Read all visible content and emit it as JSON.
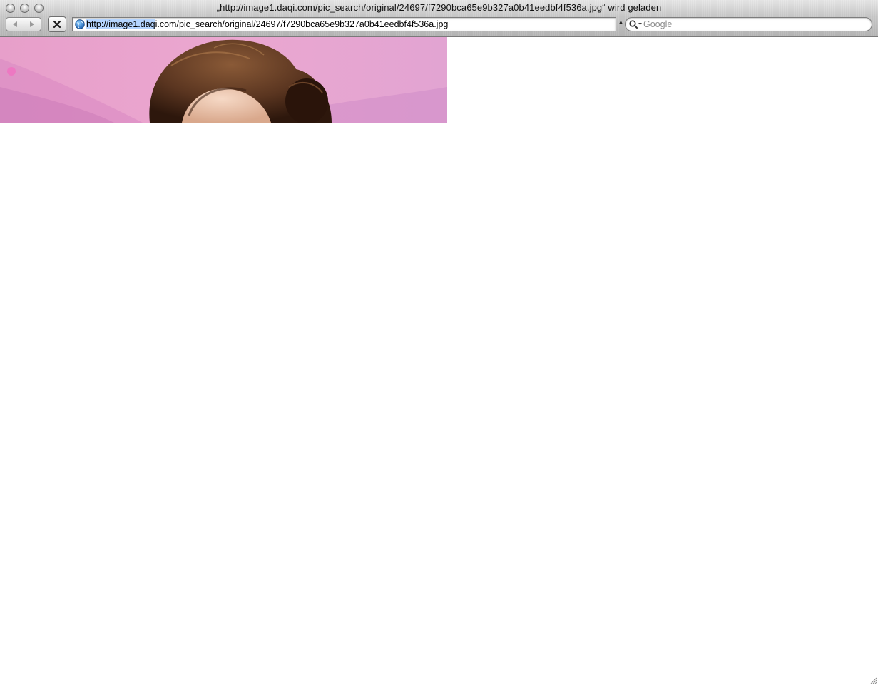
{
  "window": {
    "title": "„http://image1.daqi.com/pic_search/original/24697/f7290bca65e9b327a0b41eedbf4f536a.jpg“ wird geladen"
  },
  "toolbar": {
    "back_icon": "back-arrow-icon",
    "forward_icon": "forward-arrow-icon",
    "stop_icon": "stop-x-icon",
    "address": {
      "url_highlighted": "http://image1.daq",
      "url_rest": "i.com/pic_search/original/24697/f7290bca65e9b327a0b41eedbf4f536a.jpg",
      "favicon": "globe-icon"
    },
    "search": {
      "placeholder": "Google",
      "value": "",
      "icon": "magnifier-icon"
    }
  },
  "content": {
    "image_state": "partially loaded photo of a person with brown hair against a pink background"
  },
  "colors": {
    "selection": "#b5d5ff",
    "image_background": "#e7a7cf",
    "hair": "#5a3520"
  }
}
